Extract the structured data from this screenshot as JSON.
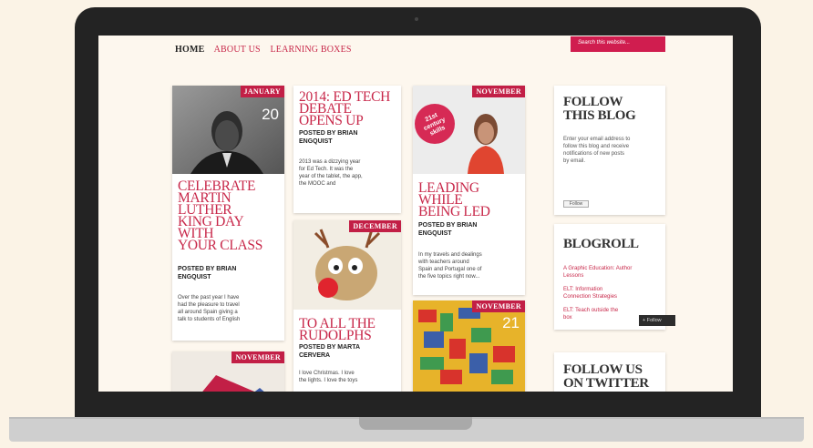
{
  "nav": {
    "items": [
      "HOME",
      "ABOUT US",
      "LEARNING BOXES"
    ]
  },
  "search": {
    "placeholder": "Search this website..."
  },
  "cards": {
    "mlk": {
      "month": "JANUARY",
      "day": "20",
      "title": [
        "CELEBRATE",
        "MARTIN",
        "LUTHER",
        "KING DAY",
        "WITH",
        "YOUR CLASS"
      ],
      "byline": [
        "POSTED BY BRIAN",
        "ENGQUIST"
      ],
      "excerpt": [
        "Over the past year I have",
        "had the pleasure to travel",
        "all around Spain giving a",
        "talk to students of English"
      ]
    },
    "edtech": {
      "title": [
        "2014: ED TECH",
        "DEBATE",
        "OPENS UP"
      ],
      "byline": [
        "POSTED BY BRIAN",
        "ENGQUIST"
      ],
      "excerpt": [
        "2013 was a dizzying year",
        "for Ed Tech. It was the",
        "year of the tablet, the app,",
        "the MOOC and"
      ]
    },
    "leading": {
      "month": "NOVEMBER",
      "image_text": "21st century skills",
      "title": [
        "LEADING",
        "WHILE",
        "BEING LED"
      ],
      "byline": [
        "POSTED BY BRIAN",
        "ENGQUIST"
      ],
      "excerpt": [
        "In my travels and dealings",
        "with teachers around",
        "Spain and Portugal one of",
        "the five topics right now..."
      ]
    },
    "rudolphs": {
      "month": "DECEMBER",
      "title": [
        "TO ALL THE",
        "RUDOLPHS"
      ],
      "byline": [
        "POSTED BY MARTA",
        "CERVERA"
      ],
      "excerpt": [
        "I love Christmas. I love",
        "the lights. I love the toys"
      ]
    },
    "bottom_left": {
      "month": "NOVEMBER"
    },
    "mosaic": {
      "month": "NOVEMBER",
      "day": "21"
    }
  },
  "sidebar": {
    "follow_blog": {
      "title": [
        "FOLLOW",
        "THIS BLOG"
      ],
      "text": [
        "Enter your email address to",
        "follow this blog and receive",
        "notifications of new posts",
        "by email."
      ],
      "button": "Follow"
    },
    "blogroll": {
      "title": "BLOGROLL",
      "links": [
        "A Graphic Education: Author",
        "Lessons",
        "ELT: Information",
        "Connection Strategies",
        "ELT: Teach outside the",
        "box"
      ]
    },
    "twitter": {
      "title": [
        "FOLLOW US",
        "ON TWITTER"
      ]
    },
    "follow_tab": "+ Follow"
  },
  "colors": {
    "accent": "#c8284a",
    "tag": "#c21f46",
    "bezel": "#232323"
  }
}
